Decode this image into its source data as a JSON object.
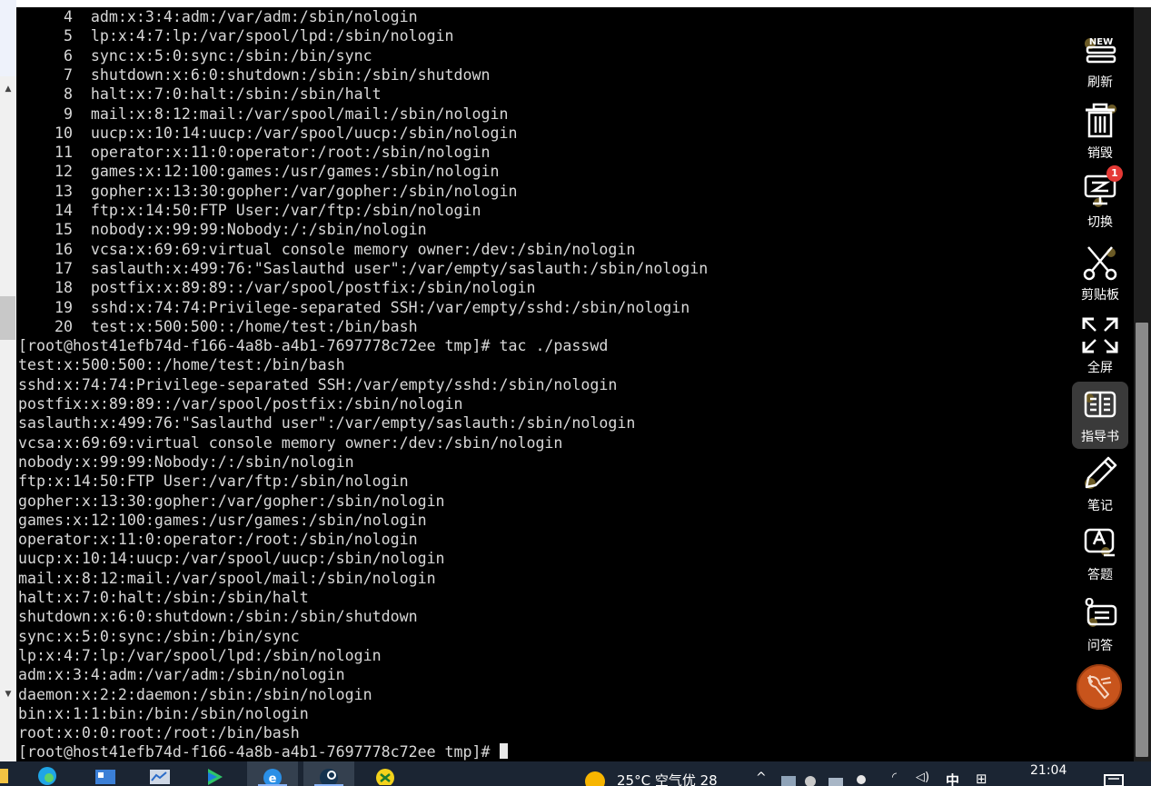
{
  "terminal": {
    "lines": [
      "     4  adm:x:3:4:adm:/var/adm:/sbin/nologin",
      "     5  lp:x:4:7:lp:/var/spool/lpd:/sbin/nologin",
      "     6  sync:x:5:0:sync:/sbin:/bin/sync",
      "     7  shutdown:x:6:0:shutdown:/sbin:/sbin/shutdown",
      "     8  halt:x:7:0:halt:/sbin:/sbin/halt",
      "     9  mail:x:8:12:mail:/var/spool/mail:/sbin/nologin",
      "    10  uucp:x:10:14:uucp:/var/spool/uucp:/sbin/nologin",
      "    11  operator:x:11:0:operator:/root:/sbin/nologin",
      "    12  games:x:12:100:games:/usr/games:/sbin/nologin",
      "    13  gopher:x:13:30:gopher:/var/gopher:/sbin/nologin",
      "    14  ftp:x:14:50:FTP User:/var/ftp:/sbin/nologin",
      "    15  nobody:x:99:99:Nobody:/:/sbin/nologin",
      "    16  vcsa:x:69:69:virtual console memory owner:/dev:/sbin/nologin",
      "    17  saslauth:x:499:76:\"Saslauthd user\":/var/empty/saslauth:/sbin/nologin",
      "    18  postfix:x:89:89::/var/spool/postfix:/sbin/nologin",
      "    19  sshd:x:74:74:Privilege-separated SSH:/var/empty/sshd:/sbin/nologin",
      "    20  test:x:500:500::/home/test:/bin/bash",
      "[root@host41efb74d-f166-4a8b-a4b1-7697778c72ee tmp]# tac ./passwd",
      "test:x:500:500::/home/test:/bin/bash",
      "sshd:x:74:74:Privilege-separated SSH:/var/empty/sshd:/sbin/nologin",
      "postfix:x:89:89::/var/spool/postfix:/sbin/nologin",
      "saslauth:x:499:76:\"Saslauthd user\":/var/empty/saslauth:/sbin/nologin",
      "vcsa:x:69:69:virtual console memory owner:/dev:/sbin/nologin",
      "nobody:x:99:99:Nobody:/:/sbin/nologin",
      "ftp:x:14:50:FTP User:/var/ftp:/sbin/nologin",
      "gopher:x:13:30:gopher:/var/gopher:/sbin/nologin",
      "games:x:12:100:games:/usr/games:/sbin/nologin",
      "operator:x:11:0:operator:/root:/sbin/nologin",
      "uucp:x:10:14:uucp:/var/spool/uucp:/sbin/nologin",
      "mail:x:8:12:mail:/var/spool/mail:/sbin/nologin",
      "halt:x:7:0:halt:/sbin:/sbin/halt",
      "shutdown:x:6:0:shutdown:/sbin:/sbin/shutdown",
      "sync:x:5:0:sync:/sbin:/bin/sync",
      "lp:x:4:7:lp:/var/spool/lpd:/sbin/nologin",
      "adm:x:3:4:adm:/var/adm:/sbin/nologin",
      "daemon:x:2:2:daemon:/sbin:/sbin/nologin",
      "bin:x:1:1:bin:/bin:/sbin/nologin",
      "root:x:0:0:root:/root:/bin/bash"
    ],
    "prompt": "[root@host41efb74d-f166-4a8b-a4b1-7697778c72ee tmp]# "
  },
  "toolbar": {
    "items": [
      {
        "label": "刷新",
        "icon": "refresh-new-icon",
        "badge_text": "NEW"
      },
      {
        "label": "销毁",
        "icon": "trash-icon"
      },
      {
        "label": "切换",
        "icon": "switch-monitor-icon",
        "badge": "1"
      },
      {
        "label": "剪贴板",
        "icon": "scissors-icon"
      },
      {
        "label": "全屏",
        "icon": "fullscreen-icon"
      },
      {
        "label": "指导书",
        "icon": "book-icon"
      },
      {
        "label": "笔记",
        "icon": "pencil-icon"
      },
      {
        "label": "答题",
        "icon": "answer-icon"
      },
      {
        "label": "问答",
        "icon": "qa-icon"
      }
    ],
    "active_index": 5,
    "wrench_icon": "wrench-icon"
  },
  "taskbar": {
    "weather": "25°C  空气优 28",
    "ime": "中",
    "clock": "21:04"
  },
  "colors": {
    "terminal_bg": "#000000",
    "terminal_fg": "#d8d8d8",
    "taskbar_bg": "#1b2533",
    "badge_red": "#e53935",
    "wrench_orange": "#c8541c"
  }
}
